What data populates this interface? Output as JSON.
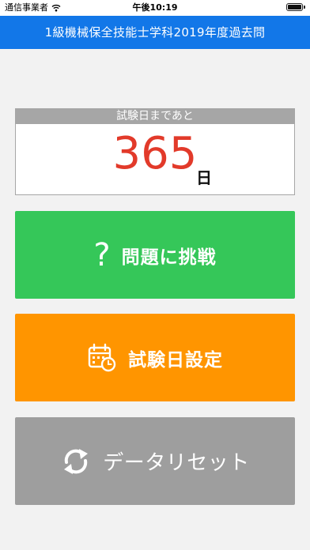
{
  "status_bar": {
    "carrier": "通信事業者",
    "time": "午後10:19"
  },
  "nav": {
    "title": "1級機械保全技能士学科2019年度過去問"
  },
  "countdown": {
    "header": "試験日まであと",
    "days": "365",
    "unit": "日",
    "number_color": "#e23a2a"
  },
  "buttons": {
    "challenge": {
      "label": "問題に挑戦",
      "icon": "question-mark-icon",
      "color": "#35c759"
    },
    "exam_date": {
      "label": "試験日設定",
      "icon": "calendar-clock-icon",
      "color": "#ff9500"
    },
    "reset": {
      "label": "データリセット",
      "icon": "refresh-icon",
      "color": "#9e9e9e"
    }
  },
  "theme": {
    "nav_color": "#1277e8",
    "background": "#f2f2f2"
  }
}
